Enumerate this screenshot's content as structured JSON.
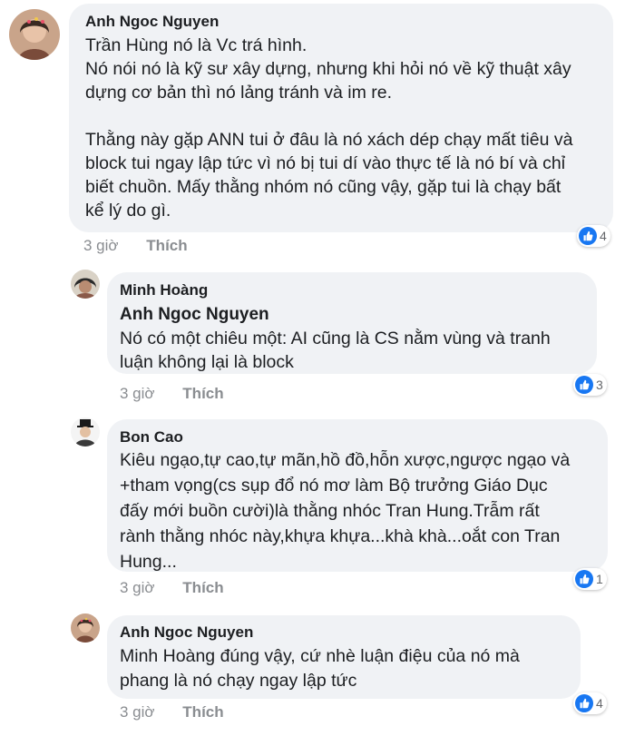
{
  "comments": [
    {
      "author": "Anh Ngoc Nguyen",
      "lines": [
        "Trần Hùng nó là Vc trá hình.",
        "Nó nói nó là kỹ sư xây dựng, nhưng khi hỏi nó về kỹ thuật xây",
        "dựng cơ bản thì nó lảng tránh và im re.",
        "",
        "Thằng này gặp ANN tui ở đâu là nó xách dép chạy mất tiêu và",
        "block tui ngay lập tức vì nó bị tui dí vào thực tế là nó bí và chỉ",
        "biết chuồn. Mấy thằng nhóm nó cũng vậy, gặp tui là chạy bất",
        "kể lý do gì."
      ],
      "time": "3 giờ",
      "like_label": "Thích",
      "reaction_count": "4"
    },
    {
      "author": "Minh Hoàng",
      "mention": "Anh Ngoc Nguyen",
      "lines": [
        "Nó có một chiêu một: AI cũng là CS nằm vùng và tranh",
        "luận không lại là block"
      ],
      "time": "3 giờ",
      "like_label": "Thích",
      "reaction_count": "3"
    },
    {
      "author": "Bon Cao",
      "lines": [
        "Kiêu ngạo,tự cao,tự mãn,hồ đồ,hỗn xược,ngược ngạo và",
        "+tham vọng(cs sụp đổ nó mơ làm Bộ trưởng Giáo Dục",
        "đấy mới buồn cười)là thằng nhóc Tran Hung.Trẫm rất",
        "rành thằng nhóc này,khựa khựa...khà khà...oắt con Tran",
        "Hung..."
      ],
      "time": "3 giờ",
      "like_label": "Thích",
      "reaction_count": "1"
    },
    {
      "author": "Anh Ngoc Nguyen",
      "lines": [
        "Minh Hoàng đúng vậy, cứ nhè luận điệu của nó mà",
        "phang là nó chạy ngay lập tức"
      ],
      "time": "3 giờ",
      "like_label": "Thích",
      "reaction_count": "4"
    }
  ],
  "colors": {
    "bubble": "#f0f2f5",
    "text": "#1c1e21",
    "meta": "#8a8d91",
    "like_badge": "#1877f2"
  },
  "icons": [
    "avatar-photo",
    "like-thumb-icon"
  ]
}
